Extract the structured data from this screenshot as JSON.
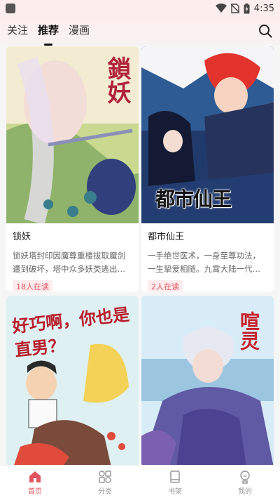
{
  "status_bar": {
    "time": "4:35"
  },
  "top_nav": {
    "tabs": [
      {
        "label": "关注"
      },
      {
        "label": "推荐",
        "active": true
      },
      {
        "label": "漫画"
      }
    ],
    "search_icon": "search-icon"
  },
  "comics": [
    {
      "title": "锁妖",
      "cover_title": "鎖妖",
      "description": "锁妖塔封印因魔尊重楼拔取魔剑遭到破坏，塔中众多妖类逃出…",
      "readers": "18人在读"
    },
    {
      "title": "都市仙王",
      "cover_title": "都市仙王",
      "description": "一手绝世医术，一身至尊功法，一生挚爱相随。九霄大陆一代…",
      "readers": "2人在读"
    },
    {
      "title": "",
      "cover_title": "好巧啊，你也是直男？"
    },
    {
      "title": "",
      "cover_title": "喧灵"
    }
  ],
  "bottom_nav": {
    "items": [
      {
        "label": "首页",
        "icon": "home-icon",
        "active": true
      },
      {
        "label": "分类",
        "icon": "category-icon"
      },
      {
        "label": "书架",
        "icon": "bookshelf-icon"
      },
      {
        "label": "我的",
        "icon": "profile-icon"
      }
    ]
  },
  "colors": {
    "accent": "#e2545f",
    "status_bg": "#fdeeed"
  }
}
